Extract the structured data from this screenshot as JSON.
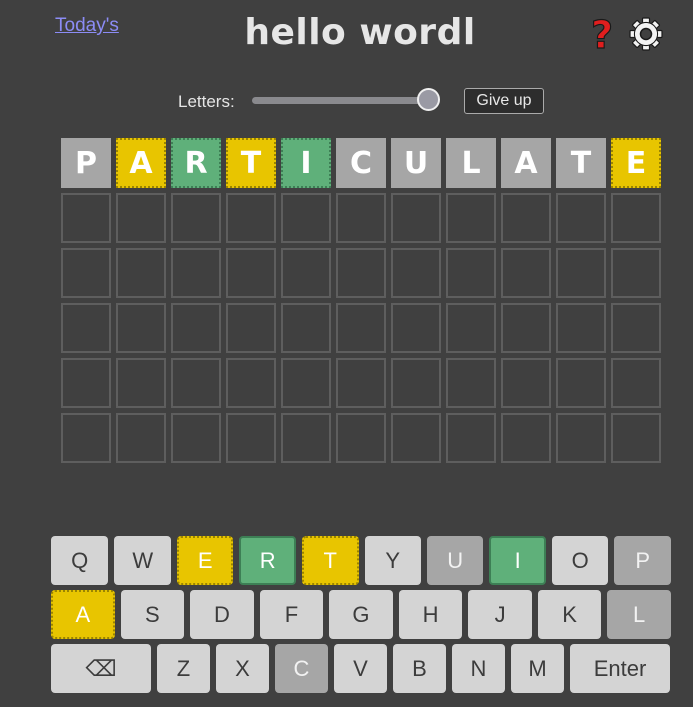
{
  "header": {
    "today_link": "Today's",
    "title": "hello wordl",
    "help_glyph": "?",
    "help_color": "#e01e1e"
  },
  "controls": {
    "letters_label": "Letters:",
    "letters_slider_fraction": 0.95,
    "give_up_label": "Give up"
  },
  "colors": {
    "background": "#404040",
    "correct": "#5fb07a",
    "present": "#e8c500",
    "absent": "#a6a6a6",
    "key_default": "#d4d4d4"
  },
  "board": {
    "columns": 11,
    "rows": 6,
    "guesses": [
      [
        {
          "letter": "P",
          "state": "absent"
        },
        {
          "letter": "A",
          "state": "present"
        },
        {
          "letter": "R",
          "state": "correct"
        },
        {
          "letter": "T",
          "state": "present"
        },
        {
          "letter": "I",
          "state": "correct"
        },
        {
          "letter": "C",
          "state": "absent"
        },
        {
          "letter": "U",
          "state": "absent"
        },
        {
          "letter": "L",
          "state": "absent"
        },
        {
          "letter": "A",
          "state": "absent"
        },
        {
          "letter": "T",
          "state": "absent"
        },
        {
          "letter": "E",
          "state": "present"
        }
      ]
    ]
  },
  "keyboard": {
    "rows": [
      [
        {
          "label": "Q",
          "state": "default",
          "width": 58
        },
        {
          "label": "W",
          "state": "default",
          "width": 57
        },
        {
          "label": "E",
          "state": "present",
          "width": 57
        },
        {
          "label": "R",
          "state": "correct",
          "width": 57
        },
        {
          "label": "T",
          "state": "present",
          "width": 57
        },
        {
          "label": "Y",
          "state": "default",
          "width": 57
        },
        {
          "label": "U",
          "state": "absent",
          "width": 57
        },
        {
          "label": "I",
          "state": "correct",
          "width": 57
        },
        {
          "label": "O",
          "state": "default",
          "width": 57
        },
        {
          "label": "P",
          "state": "absent",
          "width": 57
        }
      ],
      [
        {
          "label": "A",
          "state": "present",
          "width": 64
        },
        {
          "label": "S",
          "state": "default",
          "width": 64
        },
        {
          "label": "D",
          "state": "default",
          "width": 64
        },
        {
          "label": "F",
          "state": "default",
          "width": 64
        },
        {
          "label": "G",
          "state": "default",
          "width": 64
        },
        {
          "label": "H",
          "state": "default",
          "width": 64
        },
        {
          "label": "J",
          "state": "default",
          "width": 64
        },
        {
          "label": "K",
          "state": "default",
          "width": 64
        },
        {
          "label": "L",
          "state": "absent",
          "width": 64
        }
      ],
      [
        {
          "label": "⌫",
          "state": "default",
          "width": 100,
          "name": "backspace-key"
        },
        {
          "label": "Z",
          "state": "default",
          "width": 53
        },
        {
          "label": "X",
          "state": "default",
          "width": 53
        },
        {
          "label": "C",
          "state": "absent",
          "width": 53
        },
        {
          "label": "V",
          "state": "default",
          "width": 53
        },
        {
          "label": "B",
          "state": "default",
          "width": 53
        },
        {
          "label": "N",
          "state": "default",
          "width": 53
        },
        {
          "label": "M",
          "state": "default",
          "width": 53
        },
        {
          "label": "Enter",
          "state": "default",
          "width": 100,
          "name": "enter-key"
        }
      ]
    ]
  }
}
